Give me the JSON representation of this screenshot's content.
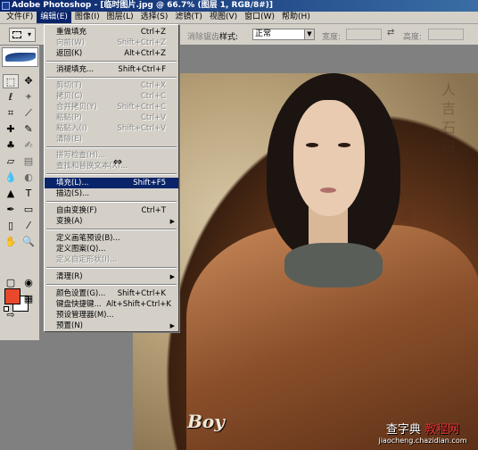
{
  "window": {
    "title": "Adobe Photoshop - [临时图片.jpg @ 66.7% (图层 1, RGB/8#)]"
  },
  "menubar": [
    {
      "label": "文件(F)"
    },
    {
      "label": "编辑(E)",
      "active": true
    },
    {
      "label": "图像(I)"
    },
    {
      "label": "图层(L)"
    },
    {
      "label": "选择(S)"
    },
    {
      "label": "滤镜(T)"
    },
    {
      "label": "视图(V)"
    },
    {
      "label": "窗口(W)"
    },
    {
      "label": "帮助(H)"
    }
  ],
  "options": {
    "feather_label": "消除锯齿",
    "style_label": "样式:",
    "style_value": "正常",
    "width_label": "宽度:",
    "height_label": "高度:"
  },
  "edit_menu": {
    "items": [
      {
        "label": "重做填充",
        "shortcut": "Ctrl+Z",
        "disabled": false
      },
      {
        "label": "向前(W)",
        "shortcut": "Shift+Ctrl+Z",
        "disabled": true
      },
      {
        "label": "返回(K)",
        "shortcut": "Alt+Ctrl+Z",
        "disabled": false
      },
      {
        "label": "消褪填充...",
        "shortcut": "Shift+Ctrl+F",
        "disabled": false
      },
      {
        "label": "剪切(T)",
        "shortcut": "Ctrl+X",
        "disabled": true
      },
      {
        "label": "拷贝(C)",
        "shortcut": "Ctrl+C",
        "disabled": true
      },
      {
        "label": "合并拷贝(Y)",
        "shortcut": "Shift+Ctrl+C",
        "disabled": true
      },
      {
        "label": "粘贴(P)",
        "shortcut": "Ctrl+V",
        "disabled": true
      },
      {
        "label": "粘贴入(I)",
        "shortcut": "Shift+Ctrl+V",
        "disabled": true
      },
      {
        "label": "清除(E)",
        "shortcut": "",
        "disabled": true
      },
      {
        "label": "拼写检查(H)...",
        "shortcut": "",
        "disabled": true
      },
      {
        "label": "查找和替换文本(X)...",
        "shortcut": "",
        "disabled": true
      },
      {
        "label": "填充(L)...",
        "shortcut": "Shift+F5",
        "disabled": false,
        "highlighted": true
      },
      {
        "label": "描边(S)...",
        "shortcut": "",
        "disabled": false
      },
      {
        "label": "自由变换(F)",
        "shortcut": "Ctrl+T",
        "disabled": false
      },
      {
        "label": "变换(A)",
        "shortcut": "",
        "disabled": false,
        "submenu": true
      },
      {
        "label": "定义画笔预设(B)...",
        "shortcut": "",
        "disabled": false
      },
      {
        "label": "定义图案(Q)...",
        "shortcut": "",
        "disabled": false
      },
      {
        "label": "定义自定形状(I)...",
        "shortcut": "",
        "disabled": true
      },
      {
        "label": "清理(R)",
        "shortcut": "",
        "disabled": false,
        "submenu": true
      },
      {
        "label": "颜色设置(G)...",
        "shortcut": "Shift+Ctrl+K",
        "disabled": false
      },
      {
        "label": "键盘快捷键...",
        "shortcut": "Alt+Shift+Ctrl+K",
        "disabled": false
      },
      {
        "label": "预设管理器(M)...",
        "shortcut": "",
        "disabled": false
      },
      {
        "label": "预置(N)",
        "shortcut": "",
        "disabled": false,
        "submenu": true
      }
    ]
  },
  "watermark": {
    "line1_a": "查字典",
    "line1_b": "教程网",
    "line2": "jiaocheng.chazidian.com"
  },
  "image_logo": "Boy",
  "colors": {
    "foreground": "#e8492c",
    "background": "#ffffff",
    "menu_highlight": "#0a246a"
  }
}
